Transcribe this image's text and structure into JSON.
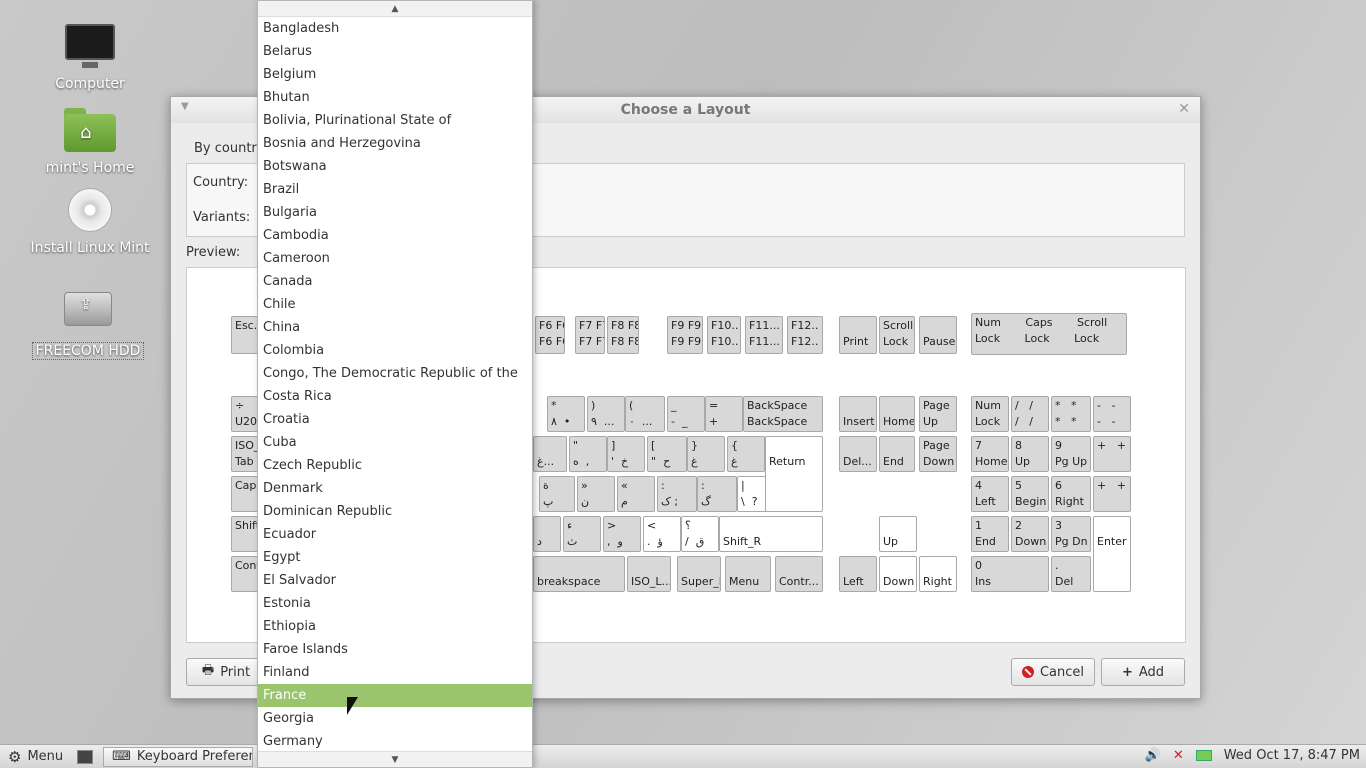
{
  "desktop": {
    "icons": [
      {
        "label": "Computer"
      },
      {
        "label": "mint's Home"
      },
      {
        "label": "Install Linux Mint"
      },
      {
        "label": "FREECOM HDD"
      }
    ]
  },
  "dialog": {
    "title": "Choose a Layout",
    "by_country_tab": "By country",
    "country_label": "Country:",
    "variants_label": "Variants:",
    "preview_label": "Preview:",
    "print_button": "Print",
    "cancel_button": "Cancel",
    "add_button": "Add"
  },
  "keyboard": {
    "keys": [
      {
        "text": "Esc..."
      },
      {
        "text": "F6 F6\nF6 F6"
      },
      {
        "text": "F7 F7\nF7 F7"
      },
      {
        "text": "F8 F8\nF8 F8"
      },
      {
        "text": "F9 F9\nF9 F9"
      },
      {
        "text": "F10..\nF10.."
      },
      {
        "text": "F11...\nF11..."
      },
      {
        "text": "F12..\nF12.."
      },
      {
        "text": "\nPrint"
      },
      {
        "text": "Scroll\nLock"
      },
      {
        "text": "\nPause"
      },
      {
        "text": "Num       Caps       Scroll\nLock       Lock       Lock"
      },
      {
        "text": "÷\nU20"
      },
      {
        "text": "*\n٨  •"
      },
      {
        "text": ")\n٩  ..."
      },
      {
        "text": "(\n٠  ..."
      },
      {
        "text": "_\n-  _"
      },
      {
        "text": "=\n+"
      },
      {
        "text": "BackSpace\nBackSpace"
      },
      {
        "text": "\nInsert"
      },
      {
        "text": "\nHome"
      },
      {
        "text": "Page\nUp"
      },
      {
        "text": "Num\nLock"
      },
      {
        "text": "/   /\n/   /"
      },
      {
        "text": "*   *\n*   *"
      },
      {
        "text": "-   -\n-   -"
      },
      {
        "text": "ISO_\nTab"
      },
      {
        "text": "\nغ..."
      },
      {
        "text": "\"\nه  ,"
      },
      {
        "text": "]\n'  خ"
      },
      {
        "text": "[\n\"  ح"
      },
      {
        "text": "}\nغ"
      },
      {
        "text": "{\nغ"
      },
      {
        "text": "\nDel..."
      },
      {
        "text": "\nEnd"
      },
      {
        "text": "Page\nDown"
      },
      {
        "text": "7\nHome"
      },
      {
        "text": "8\nUp"
      },
      {
        "text": "9\nPg Up"
      },
      {
        "text": "+   +"
      },
      {
        "text": "Caps"
      },
      {
        "text": "ة\nپ"
      },
      {
        "text": "»\nن"
      },
      {
        "text": "«\nم"
      },
      {
        "text": ":\nک ;"
      },
      {
        "text": ":\nگ"
      },
      {
        "text": "|\n\\  ?"
      },
      {
        "text": "\nReturn"
      },
      {
        "text": "4\nLeft"
      },
      {
        "text": "5\nBegin"
      },
      {
        "text": "6\nRight"
      },
      {
        "text": "+   +"
      },
      {
        "text": "Shift"
      },
      {
        "text": "\nد"
      },
      {
        "text": "ء\nث"
      },
      {
        "text": ">\n,  و"
      },
      {
        "text": "<\n.  ؤ"
      },
      {
        "text": "؟\n/  ق"
      },
      {
        "text": "\nShift_R"
      },
      {
        "text": "\nUp"
      },
      {
        "text": "1\nEnd"
      },
      {
        "text": "2\nDown"
      },
      {
        "text": "3\nPg Dn"
      },
      {
        "text": "\nEnter"
      },
      {
        "text": "Cont"
      },
      {
        "text": "\nbreakspace"
      },
      {
        "text": "\nISO_L..."
      },
      {
        "text": "\nSuper_R"
      },
      {
        "text": "\nMenu"
      },
      {
        "text": "\nContr..."
      },
      {
        "text": "\nLeft"
      },
      {
        "text": "\nDown"
      },
      {
        "text": "\nRight"
      },
      {
        "text": "0\nIns"
      },
      {
        "text": ".\nDel"
      }
    ]
  },
  "dropdown": {
    "selected": "France",
    "items": [
      "Bangladesh",
      "Belarus",
      "Belgium",
      "Bhutan",
      "Bolivia, Plurinational State of",
      "Bosnia and Herzegovina",
      "Botswana",
      "Brazil",
      "Bulgaria",
      "Cambodia",
      "Cameroon",
      "Canada",
      "Chile",
      "China",
      "Colombia",
      "Congo, The Democratic Republic of the",
      "Costa Rica",
      "Croatia",
      "Cuba",
      "Czech Republic",
      "Denmark",
      "Dominican Republic",
      "Ecuador",
      "Egypt",
      "El Salvador",
      "Estonia",
      "Ethiopia",
      "Faroe Islands",
      "Finland",
      "France",
      "Georgia",
      "Germany"
    ]
  },
  "taskbar": {
    "menu_label": "Menu",
    "window_button": "Keyboard Preferences",
    "clock": "Wed Oct 17,  8:47 PM"
  }
}
